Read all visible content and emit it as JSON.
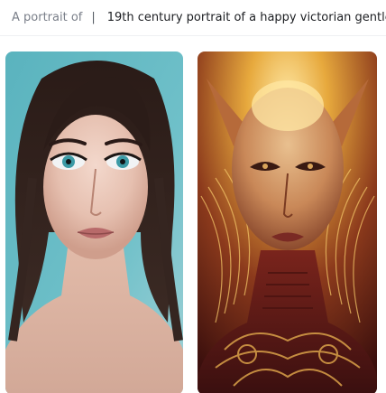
{
  "prompt_bar": {
    "prefix": "A portrait of",
    "divider": "|",
    "text": "19th century portrait of a happy victorian gentle"
  },
  "gallery": {
    "images": [
      {
        "name": "portrait-woman-teal-background"
      },
      {
        "name": "portrait-golden-alien-figure"
      }
    ]
  },
  "colors": {
    "teal_background": "#5fb3bf",
    "gold_accent": "#d9a13a",
    "dark_red": "#5a1a1a"
  }
}
